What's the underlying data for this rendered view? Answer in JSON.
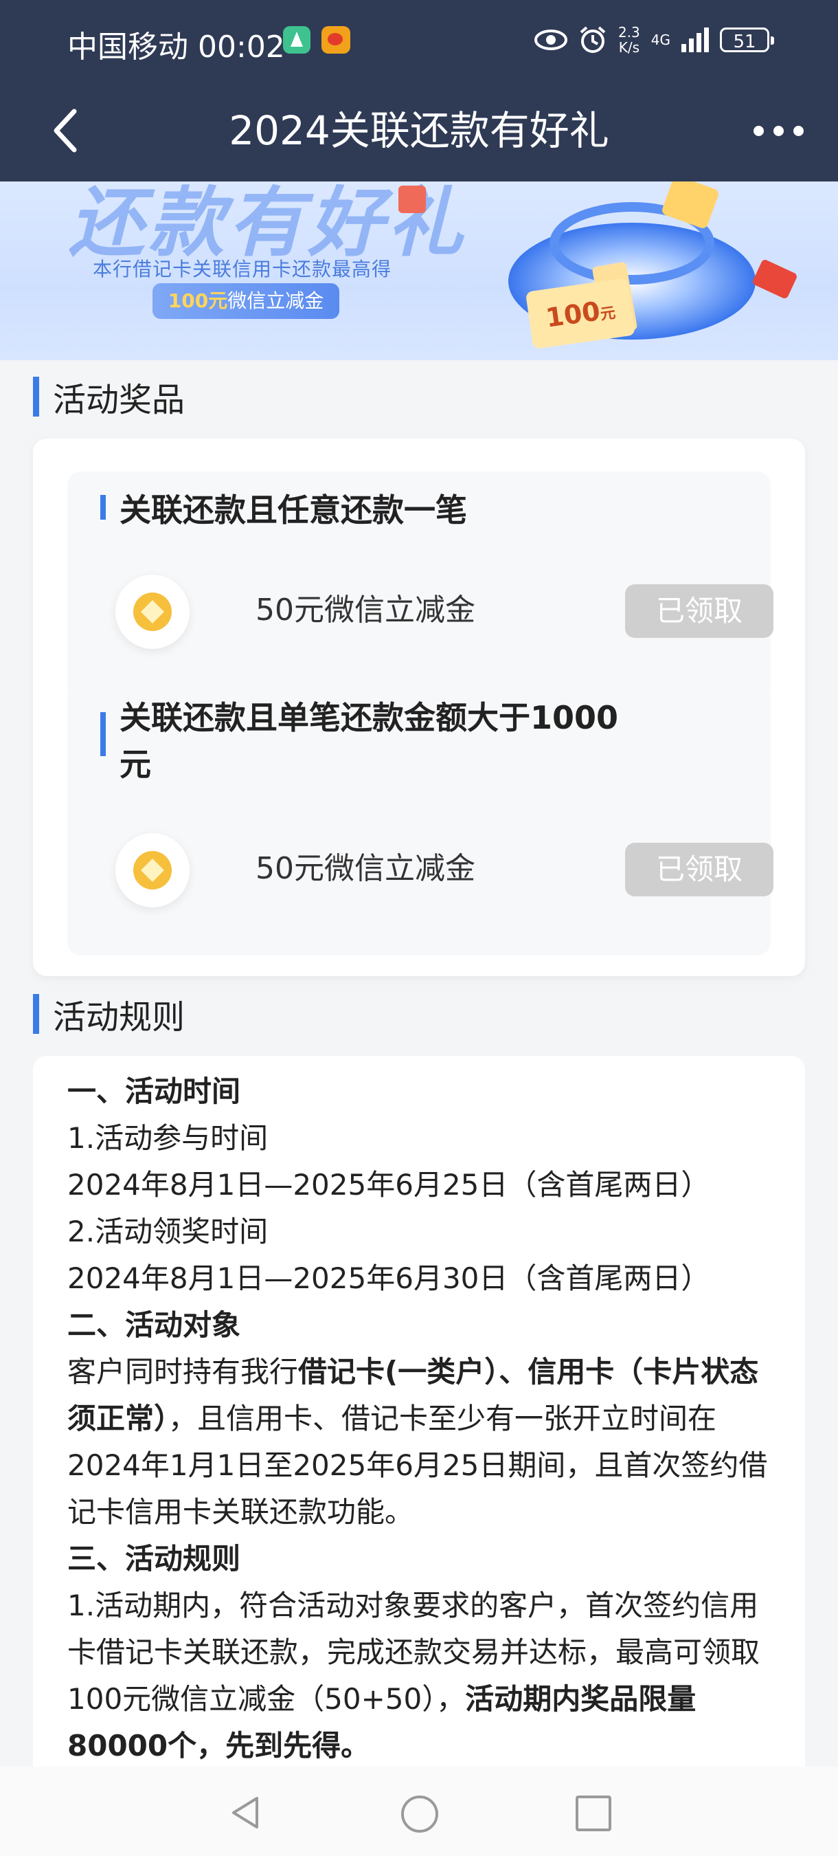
{
  "status_bar": {
    "carrier": "中国移动",
    "time": "00:02",
    "net_speed_value": "2.3",
    "net_speed_unit": "K/s",
    "network": "4G",
    "battery": "51"
  },
  "header": {
    "title": "2024关联还款有好礼"
  },
  "banner": {
    "script_text": "还款有好礼",
    "subtitle": "本行借记卡关联信用卡还款最高得",
    "pill_amount": "100元",
    "pill_text": "微信立减金",
    "coupon_amount": "100",
    "coupon_unit": "元"
  },
  "prizes_section": {
    "heading": "活动奖品",
    "items": [
      {
        "title": "关联还款且任意还款一笔",
        "reward": "50元微信立减金",
        "status": "已领取"
      },
      {
        "title": "关联还款且单笔还款金额大于1000元",
        "reward": "50元微信立减金",
        "status": "已领取"
      }
    ]
  },
  "rules_section": {
    "heading": "活动规则",
    "h1": "一、活动时间",
    "l1": "1.活动参与时间",
    "l2": "2024年8月1日—2025年6月25日（含首尾两日）",
    "l3": "2.活动领奖时间",
    "l4": "2024年8月1日—2025年6月30日（含首尾两日）",
    "h2": "二、活动对象",
    "p2_a": "客户同时持有我行",
    "p2_b": "借记卡(一类户）、信用卡（卡片状态须正常）",
    "p2_c": "，且信用卡、借记卡至少有一张开立时间在2024年1月1日至2025年6月25日期间，且首次签约借记卡信用卡关联还款功能。",
    "h3": "三、活动规则",
    "p3_a": "1.活动期内，符合活动对象要求的客户，首次签约信用卡借记卡关联还款，完成还款交易并达标，最高可领取100元微信立减金（50+50），",
    "p3_b": "活动期内奖品限量80000个，先到先得。"
  }
}
